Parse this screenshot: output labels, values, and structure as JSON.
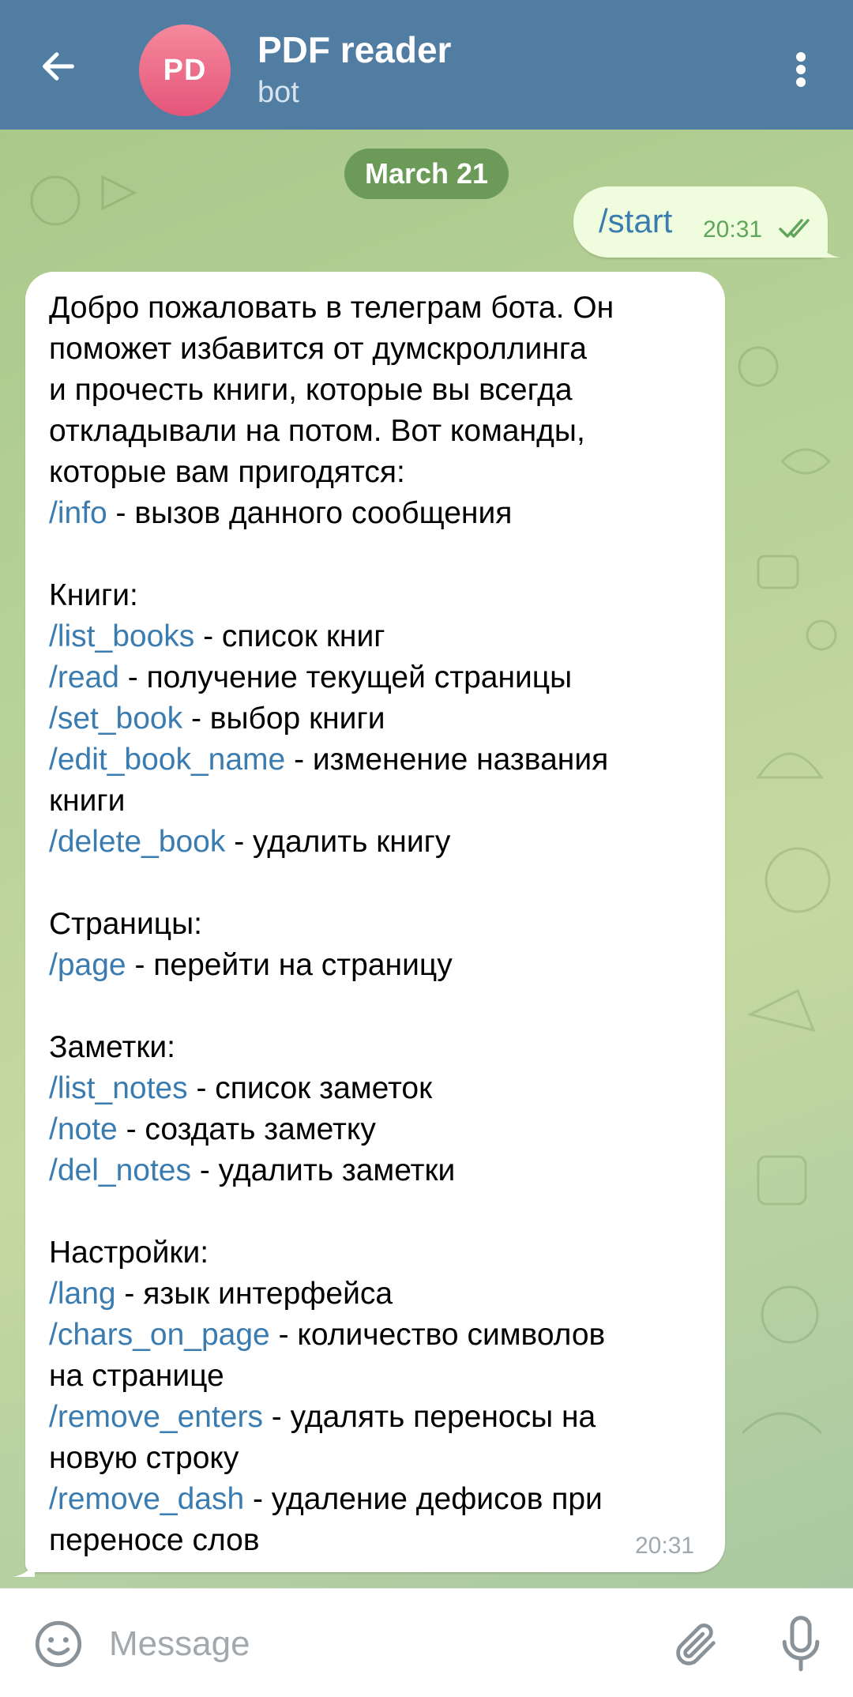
{
  "header": {
    "avatar_initials": "PD",
    "title": "PDF reader",
    "subtitle": "bot"
  },
  "chat": {
    "date_badge": "March 21",
    "outgoing": {
      "text": "/start",
      "time": "20:31",
      "status": "read"
    },
    "incoming": {
      "time": "20:31",
      "lines": [
        {
          "cmd": "",
          "text": "Добро пожаловать в телеграм бота. Он"
        },
        {
          "cmd": "",
          "text": "поможет избавится от думскроллинга"
        },
        {
          "cmd": "",
          "text": "и прочесть книги, которые вы всегда"
        },
        {
          "cmd": "",
          "text": "откладывали на потом. Вот команды,"
        },
        {
          "cmd": "",
          "text": "которые вам пригодятся:"
        },
        {
          "cmd": "/info",
          "text": " - вызов данного сообщения"
        },
        {
          "cmd": "",
          "text": ""
        },
        {
          "cmd": "",
          "text": "Книги:"
        },
        {
          "cmd": "/list_books",
          "text": " - список книг"
        },
        {
          "cmd": "/read",
          "text": " - получение текущей страницы"
        },
        {
          "cmd": "/set_book",
          "text": " - выбор книги"
        },
        {
          "cmd": "/edit_book_name",
          "text": " - изменение названия"
        },
        {
          "cmd": "",
          "text": "книги"
        },
        {
          "cmd": "/delete_book",
          "text": " - удалить книгу"
        },
        {
          "cmd": "",
          "text": ""
        },
        {
          "cmd": "",
          "text": "Страницы:"
        },
        {
          "cmd": "/page",
          "text": " - перейти на страницу"
        },
        {
          "cmd": "",
          "text": ""
        },
        {
          "cmd": "",
          "text": "Заметки:"
        },
        {
          "cmd": "/list_notes",
          "text": " - список заметок"
        },
        {
          "cmd": "/note",
          "text": " - создать заметку"
        },
        {
          "cmd": "/del_notes",
          "text": " - удалить заметки"
        },
        {
          "cmd": "",
          "text": ""
        },
        {
          "cmd": "",
          "text": "Настройки:"
        },
        {
          "cmd": "/lang",
          "text": " - язык интерфейса"
        },
        {
          "cmd": "/chars_on_page",
          "text": " - количество символов"
        },
        {
          "cmd": "",
          "text": "на странице"
        },
        {
          "cmd": "/remove_enters",
          "text": " - удалять переносы на"
        },
        {
          "cmd": "",
          "text": "новую строку"
        },
        {
          "cmd": "/remove_dash",
          "text": " - удаление дефисов при"
        },
        {
          "cmd": "",
          "text": "переносе слов"
        }
      ]
    }
  },
  "input": {
    "placeholder": "Message",
    "value": ""
  },
  "icons": {
    "back": "arrow-left-icon",
    "menu": "more-vertical-icon",
    "emoji": "smile-icon",
    "attach": "paperclip-icon",
    "mic": "microphone-icon",
    "read_status": "double-check-icon"
  },
  "colors": {
    "header_bg": "#517da2",
    "command_link": "#3a7bb0",
    "outgoing_bubble": "#effdde",
    "incoming_bubble": "#ffffff",
    "date_badge_bg": "#6a9a58",
    "read_check": "#5fa55a"
  }
}
